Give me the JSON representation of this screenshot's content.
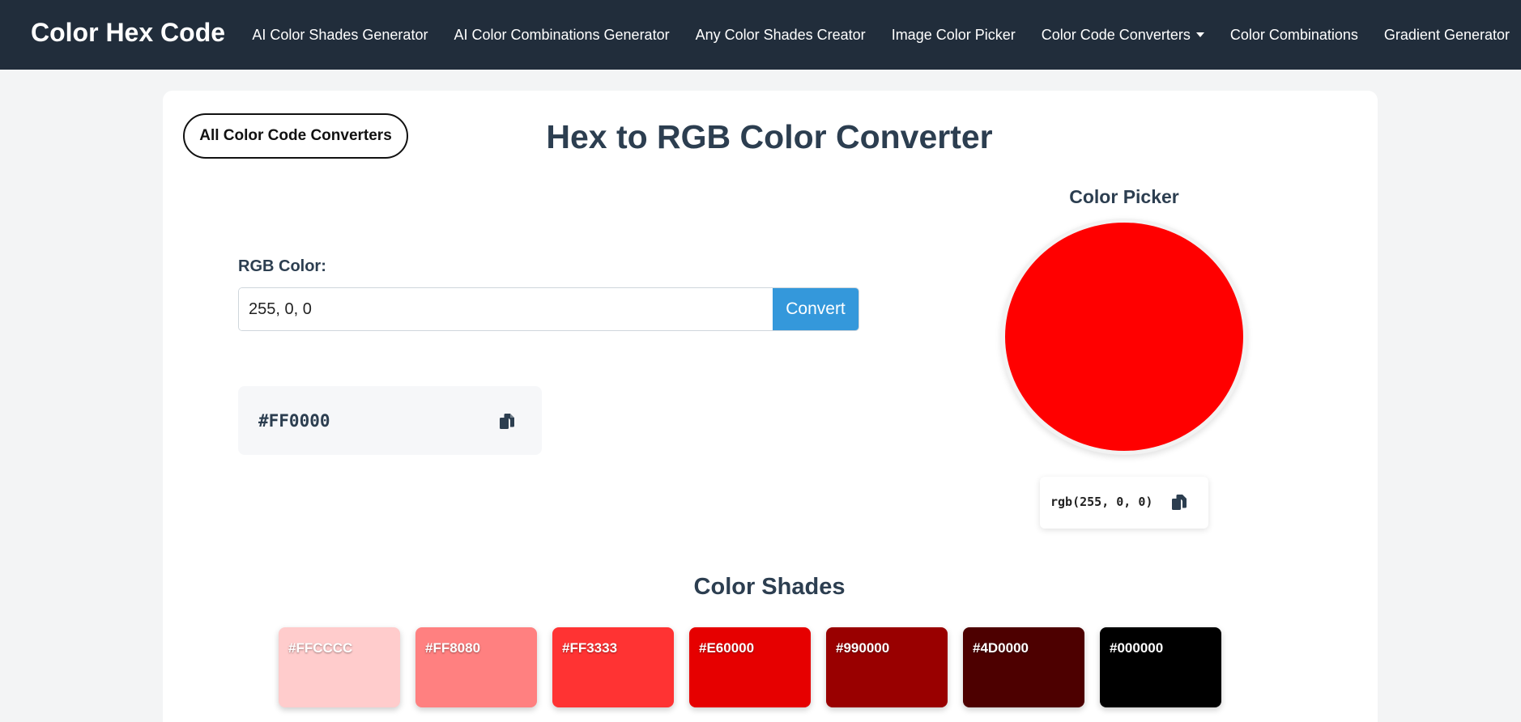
{
  "navbar": {
    "brand": "Color Hex Code",
    "links": [
      {
        "label": "AI Color Shades Generator"
      },
      {
        "label": "AI Color Combinations Generator"
      },
      {
        "label": "Any Color Shades Creator"
      },
      {
        "label": "Image Color Picker"
      },
      {
        "label": "Color Code Converters",
        "has_dropdown": true
      },
      {
        "label": "Color Combinations"
      },
      {
        "label": "Gradient Generator"
      }
    ],
    "background": "#212d3b"
  },
  "all_converters_button": "All Color Code Converters",
  "page_title": "Hex to RGB Color Converter",
  "converter": {
    "input_label": "RGB Color:",
    "input_value": "255, 0, 0",
    "convert_label": "Convert",
    "hex_result": "#FF0000",
    "accent": "#3498db"
  },
  "picker": {
    "title": "Color Picker",
    "color": "#FF0000",
    "rgb_text": "rgb(255, 0, 0)"
  },
  "shades": {
    "title": "Color Shades",
    "items": [
      {
        "hex": "#FFCCCC"
      },
      {
        "hex": "#FF8080"
      },
      {
        "hex": "#FF3333"
      },
      {
        "hex": "#E60000"
      },
      {
        "hex": "#990000"
      },
      {
        "hex": "#4D0000"
      },
      {
        "hex": "#000000"
      }
    ]
  },
  "icons": {
    "copy": "copy-icon",
    "dropdown": "caret-down-icon"
  }
}
